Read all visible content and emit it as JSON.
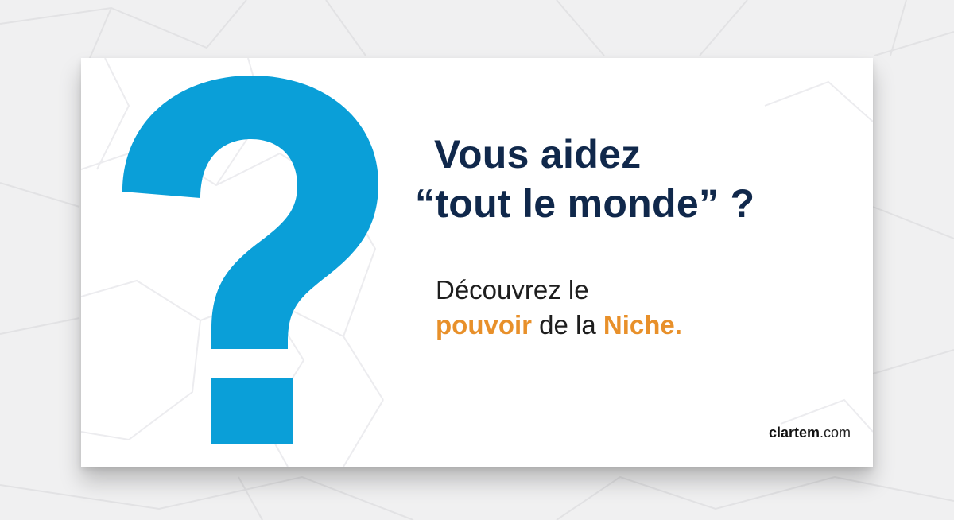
{
  "colors": {
    "navy": "#10284b",
    "blue": "#0a9fd8",
    "orange": "#e8902a"
  },
  "graphic": {
    "icon": "question-mark-icon"
  },
  "headline": {
    "line1": "Vous aidez",
    "line2": "“tout le monde” ?"
  },
  "subline": {
    "line1": "Découvrez le",
    "highlight1": "pouvoir",
    "middle": " de la ",
    "highlight2": "Niche."
  },
  "footer": {
    "brand": "clartem",
    "domain": ".com"
  }
}
